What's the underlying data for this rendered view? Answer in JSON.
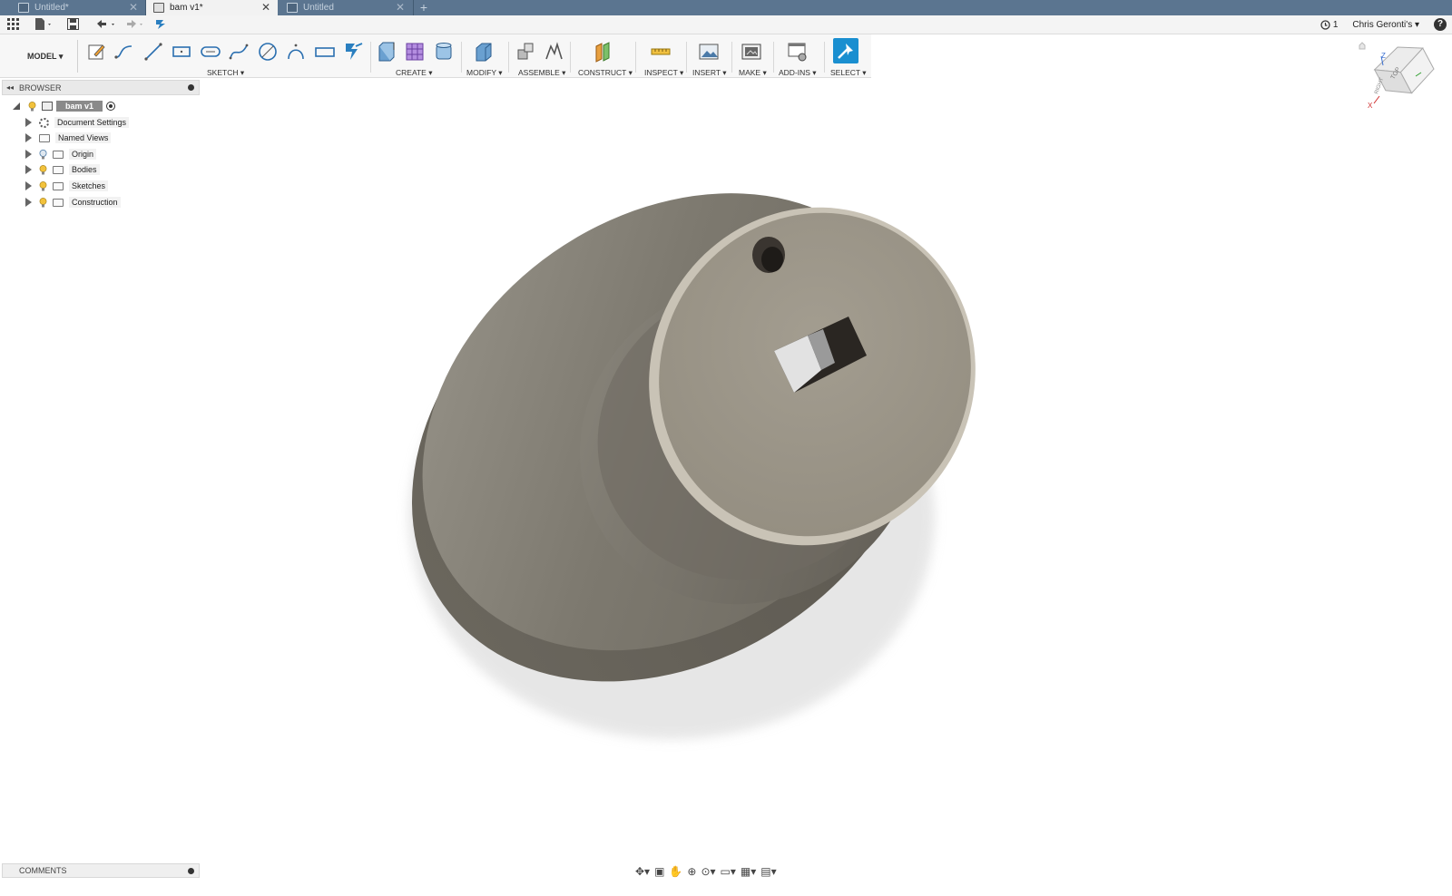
{
  "tabs": [
    {
      "label": "Untitled*",
      "active": false
    },
    {
      "label": "bam v1*",
      "active": true
    },
    {
      "label": "Untitled",
      "active": false
    }
  ],
  "qat": {
    "job_count": "1",
    "user": "Chris Geronti's ▾",
    "help": "?"
  },
  "ribbon": {
    "workspace": "MODEL ▾",
    "groups": [
      {
        "label": "SKETCH ▾"
      },
      {
        "label": "CREATE ▾"
      },
      {
        "label": "MODIFY ▾"
      },
      {
        "label": "ASSEMBLE ▾"
      },
      {
        "label": "CONSTRUCT ▾"
      },
      {
        "label": "INSPECT ▾"
      },
      {
        "label": "INSERT ▾"
      },
      {
        "label": "MAKE ▾"
      },
      {
        "label": "ADD-INS ▾"
      },
      {
        "label": "SELECT ▾"
      }
    ]
  },
  "browser": {
    "title": "BROWSER",
    "root": "bam v1",
    "items": [
      {
        "label": "Document Settings",
        "icon": "gear-icon"
      },
      {
        "label": "Named Views",
        "icon": "folder-icon"
      },
      {
        "label": "Origin",
        "icon": "folder-icon"
      },
      {
        "label": "Bodies",
        "icon": "folder-icon"
      },
      {
        "label": "Sketches",
        "icon": "folder-icon"
      },
      {
        "label": "Construction",
        "icon": "folder-icon"
      }
    ]
  },
  "comments": {
    "title": "COMMENTS"
  },
  "viewcube": {
    "face_top": "TOP",
    "face_right": "RIGHT",
    "axis_x": "X",
    "axis_z": "Z"
  },
  "colors": {
    "tabbar": "#5b7590",
    "select_accent": "#1a8fd0",
    "model": "#8a8579"
  }
}
